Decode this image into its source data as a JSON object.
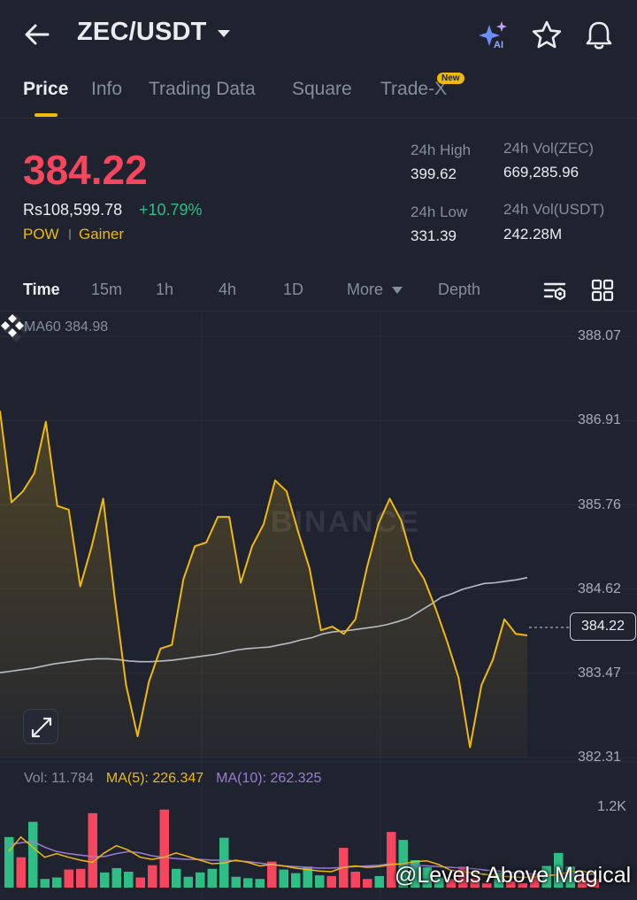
{
  "header": {
    "pair": "ZEC/USDT",
    "icons": [
      "back-arrow-icon",
      "caret-down-icon",
      "ai-sparkle-icon",
      "star-icon",
      "bell-icon"
    ],
    "ai_label": "AI"
  },
  "tabs": {
    "items": [
      {
        "label": "Price",
        "active": true
      },
      {
        "label": "Info"
      },
      {
        "label": "Trading Data"
      },
      {
        "label": "Square"
      },
      {
        "label": "Trade-X"
      }
    ],
    "new_badge": "New"
  },
  "ticker": {
    "last_price": "384.22",
    "fiat_price": "Rs108,599.78",
    "change": "+10.79%",
    "tags": [
      "POW",
      "Gainer"
    ],
    "stats": {
      "high_label": "24h High",
      "high_value": "399.62",
      "low_label": "24h Low",
      "low_value": "331.39",
      "vol_base_label": "24h Vol(ZEC)",
      "vol_base_value": "669,285.96",
      "vol_quote_label": "24h Vol(USDT)",
      "vol_quote_value": "242.28M"
    }
  },
  "intervals": {
    "items": [
      "Time",
      "15m",
      "1h",
      "4h",
      "1D",
      "More",
      "Depth"
    ],
    "active": "Time"
  },
  "chart": {
    "ma60_legend": "MA60 384.98",
    "y_ticks": [
      "388.07",
      "386.91",
      "385.76",
      "384.62",
      "383.47",
      "382.31"
    ],
    "last_price_tag": "384.22",
    "watermark": "BINANCE",
    "volume": {
      "vol_label": "Vol: 11.784",
      "ma5_label": "MA(5): 226.347",
      "ma10_label": "MA(10): 262.325",
      "y_tick": "1.2K"
    },
    "credit": "@Levels Above Magical",
    "colors": {
      "up": "#2ebd85",
      "down": "#f6465d",
      "price_line": "#f0b90b",
      "ma60": "#b7bdc6",
      "ma5": "#f0b90b",
      "ma10": "#9c7bd6"
    }
  },
  "chart_data": {
    "type": "area",
    "ylim": [
      382.31,
      388.07
    ],
    "series": [
      {
        "name": "Price",
        "values": [
          387.05,
          385.8,
          385.95,
          386.2,
          386.9,
          385.75,
          385.7,
          384.65,
          385.2,
          385.85,
          384.5,
          383.3,
          382.6,
          383.35,
          383.8,
          383.85,
          384.75,
          385.2,
          385.25,
          385.6,
          385.6,
          384.7,
          385.2,
          385.5,
          386.1,
          385.95,
          385.4,
          384.9,
          384.05,
          384.1,
          384.0,
          384.2,
          384.9,
          385.5,
          385.85,
          385.55,
          385.0,
          384.75,
          384.35,
          383.9,
          383.4,
          382.45,
          383.3,
          383.65,
          384.2,
          384.0,
          383.98
        ]
      },
      {
        "name": "MA60",
        "values": [
          383.47,
          383.49,
          383.51,
          383.53,
          383.56,
          383.59,
          383.61,
          383.63,
          383.65,
          383.66,
          383.66,
          383.65,
          383.63,
          383.62,
          383.62,
          383.63,
          383.64,
          383.66,
          383.68,
          383.7,
          383.72,
          383.75,
          383.78,
          383.8,
          383.81,
          383.82,
          383.85,
          383.88,
          383.92,
          383.95,
          384.0,
          384.03,
          384.04,
          384.06,
          384.08,
          384.1,
          384.13,
          384.17,
          384.22,
          384.31,
          384.4,
          384.5,
          384.55,
          384.61,
          384.65,
          384.69,
          384.7,
          384.72,
          384.74,
          384.77
        ]
      }
    ],
    "volume": {
      "values": [
        700,
        420,
        910,
        120,
        140,
        250,
        260,
        1030,
        210,
        270,
        220,
        140,
        310,
        1080,
        260,
        150,
        210,
        260,
        690,
        150,
        130,
        120,
        360,
        250,
        200,
        290,
        170,
        160,
        550,
        220,
        120,
        160,
        770,
        660,
        380,
        280,
        140,
        120,
        290,
        130,
        60,
        210,
        90,
        60,
        200,
        300,
        480,
        290,
        140,
        120
      ]
    },
    "ma5": [
      500,
      700,
      560,
      420,
      470,
      420,
      380,
      350,
      480,
      580,
      520,
      420,
      390,
      420,
      480,
      430,
      380,
      330,
      340,
      380,
      350,
      300,
      320,
      300,
      270,
      250,
      230,
      220,
      280,
      300,
      280,
      290,
      320,
      330,
      360,
      370,
      320,
      240,
      220,
      200,
      180,
      160,
      150,
      140,
      150,
      160,
      180,
      220,
      230,
      190
    ],
    "ma10": [
      600,
      620,
      640,
      560,
      500,
      470,
      450,
      430,
      430,
      470,
      500,
      480,
      440,
      420,
      400,
      390,
      390,
      380,
      380,
      370,
      360,
      340,
      320,
      300,
      290,
      280,
      270,
      270,
      280,
      290,
      300,
      310,
      330,
      320,
      310,
      300,
      290,
      280,
      270,
      260,
      240,
      230,
      210,
      200,
      190,
      180,
      170,
      170,
      180,
      180
    ]
  }
}
